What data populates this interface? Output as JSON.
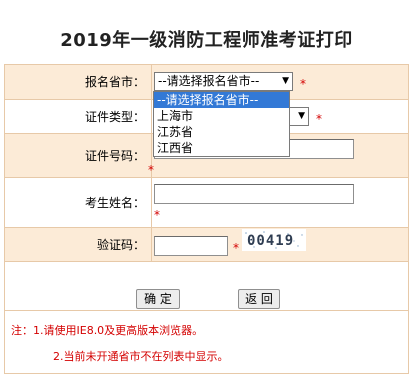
{
  "page": {
    "title": "2019年一级消防工程师准考证打印"
  },
  "form": {
    "province_label": "报名省市：",
    "province_selected": "--请选择报名省市--",
    "province_options": [
      "--请选择报名省市--",
      "上海市",
      "江苏省",
      "江西省"
    ],
    "cert_type_label": "证件类型：",
    "cert_number_label": "证件号码：",
    "name_label": "考生姓名：",
    "captcha_label": "验证码：",
    "captcha_text": "00419",
    "required_mark": "*"
  },
  "buttons": {
    "confirm": "确 定",
    "back": "返 回"
  },
  "notes": {
    "line1": "注：1.请使用IE8.0及更高版本浏览器。",
    "line2": "2.当前未开通省市不在列表中显示。"
  },
  "colors": {
    "accent_red": "#d40000",
    "row_bg": "#fcebd7",
    "border": "#e7c9a8",
    "dropdown_highlight": "#3379d6"
  }
}
